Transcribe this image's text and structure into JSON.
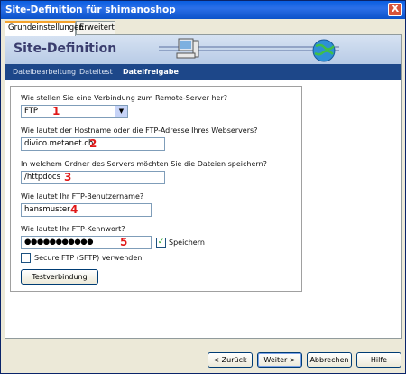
{
  "window": {
    "title": "Site-Definition für shimanoshop",
    "close_glyph": "X"
  },
  "tabs": [
    {
      "label": "Grundeinstellungen",
      "active": true
    },
    {
      "label": "Erweitert",
      "active": false
    }
  ],
  "header": {
    "title": "Site-Definition"
  },
  "nav": [
    {
      "label": "Dateibearbeitung",
      "active": false
    },
    {
      "label": "Dateitest",
      "active": false
    },
    {
      "label": "Dateifreigabe",
      "active": true
    }
  ],
  "form": {
    "q1": "Wie stellen Sie eine Verbindung zum Remote-Server her?",
    "connection_value": "FTP",
    "arrow": "▼",
    "q2": "Wie lautet der Hostname oder die FTP-Adresse Ihres Webservers?",
    "host_value": "divico.metanet.ch",
    "q3": "In welchem Ordner des Servers möchten Sie die Dateien speichern?",
    "folder_value": "/httpdocs",
    "q4": "Wie lautet Ihr FTP-Benutzername?",
    "user_value": "hansmuster",
    "q5": "Wie lautet Ihr FTP-Kennwort?",
    "password_value": "●●●●●●●●●●●",
    "save_label": "Speichern",
    "save_checked": "✓",
    "sftp_label": "Secure FTP (SFTP) verwenden",
    "test_button": "Testverbindung",
    "markers": [
      "1",
      "2",
      "3",
      "4",
      "5"
    ]
  },
  "footer": {
    "back": "< Zurück",
    "next": "Weiter >",
    "cancel": "Abbrechen",
    "help": "Hilfe"
  },
  "colors": {
    "titlebar": "#0a5ee0",
    "nav": "#1d4789",
    "marker": "#e01818"
  }
}
